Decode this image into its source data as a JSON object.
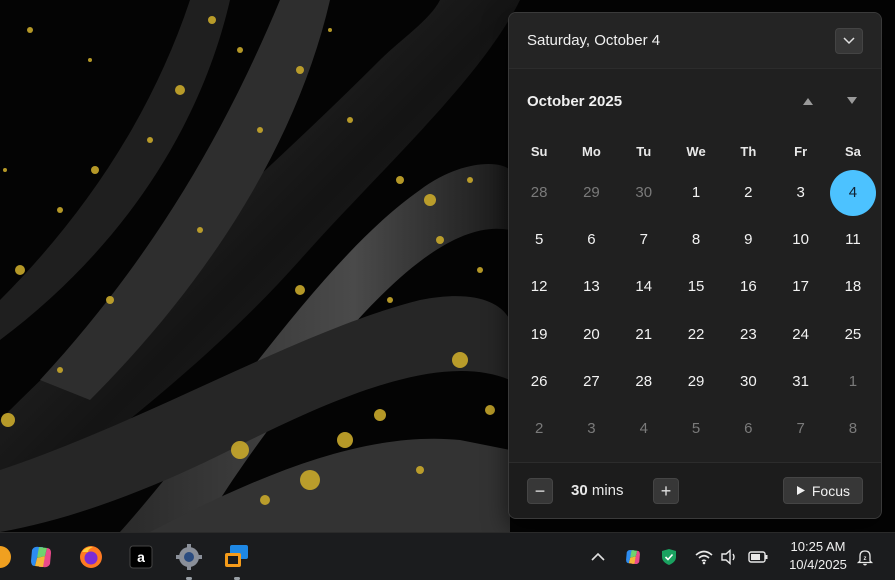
{
  "calendar": {
    "date_title": "Saturday, October 4",
    "month_title": "October 2025",
    "weekdays": [
      "Su",
      "Mo",
      "Tu",
      "We",
      "Th",
      "Fr",
      "Sa"
    ],
    "days": [
      {
        "d": "28",
        "other": true
      },
      {
        "d": "29",
        "other": true
      },
      {
        "d": "30",
        "other": true
      },
      {
        "d": "1"
      },
      {
        "d": "2"
      },
      {
        "d": "3"
      },
      {
        "d": "4",
        "today": true
      },
      {
        "d": "5"
      },
      {
        "d": "6"
      },
      {
        "d": "7"
      },
      {
        "d": "8"
      },
      {
        "d": "9"
      },
      {
        "d": "10"
      },
      {
        "d": "11"
      },
      {
        "d": "12"
      },
      {
        "d": "13"
      },
      {
        "d": "14"
      },
      {
        "d": "15"
      },
      {
        "d": "16"
      },
      {
        "d": "17"
      },
      {
        "d": "18"
      },
      {
        "d": "19"
      },
      {
        "d": "20"
      },
      {
        "d": "21"
      },
      {
        "d": "22"
      },
      {
        "d": "23"
      },
      {
        "d": "24"
      },
      {
        "d": "25"
      },
      {
        "d": "26"
      },
      {
        "d": "27"
      },
      {
        "d": "28"
      },
      {
        "d": "29"
      },
      {
        "d": "30"
      },
      {
        "d": "31"
      },
      {
        "d": "1",
        "other": true
      },
      {
        "d": "2",
        "other": true
      },
      {
        "d": "3",
        "other": true
      },
      {
        "d": "4",
        "other": true
      },
      {
        "d": "5",
        "other": true
      },
      {
        "d": "6",
        "other": true
      },
      {
        "d": "7",
        "other": true
      },
      {
        "d": "8",
        "other": true
      }
    ],
    "accent_color": "#4cc2ff"
  },
  "focus": {
    "minutes_value": "30",
    "minutes_unit": "mins",
    "decrease_label": "−",
    "increase_label": "+",
    "focus_label": "Focus"
  },
  "taskbar": {
    "apps": [
      "copilot-icon",
      "firefox-icon",
      "a-app-icon",
      "settings-gear-icon",
      "remote-desktop-icon"
    ],
    "tray": [
      "chevron-up-icon",
      "copilot-tray-icon",
      "shield-icon",
      "wifi-icon",
      "speaker-icon",
      "battery-icon",
      "notification-icon"
    ],
    "clock_time": "10:25 AM",
    "clock_date": "10/4/2025"
  }
}
